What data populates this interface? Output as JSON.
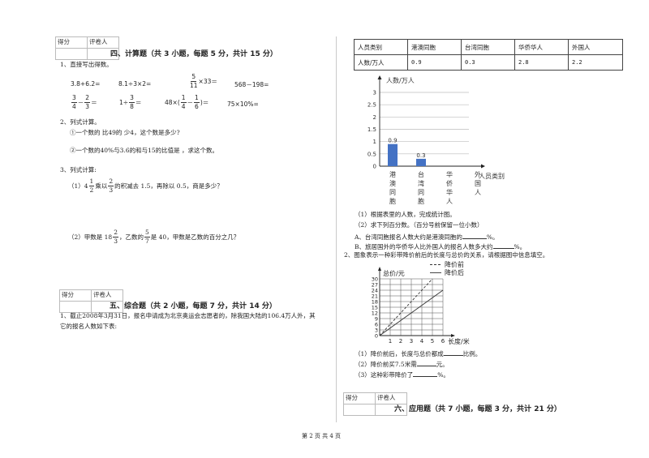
{
  "score_box": {
    "score_label": "得分",
    "grader_label": "评卷人"
  },
  "section4": {
    "title": "四、计算题（共 3 小题，每题 5 分，共计 15 分）",
    "q1": {
      "label": "1、直接写出得数。",
      "row1": [
        "3.8+6.2=",
        "8.1÷3×2=",
        "×33＝",
        "568－198="
      ],
      "frac_5_11": {
        "num": "5",
        "den": "11"
      },
      "row2": {
        "a": {
          "f1": {
            "num": "3",
            "den": "4"
          },
          "op": "－",
          "f2": {
            "num": "2",
            "den": "3"
          },
          "eq": "＝"
        },
        "b": {
          "pre": "1÷",
          "f": {
            "num": "3",
            "den": "8"
          },
          "eq": "＝"
        },
        "c": {
          "pre": "48×(",
          "f1": {
            "num": "1",
            "den": "4"
          },
          "op": "－",
          "f2": {
            "num": "1",
            "den": "6"
          },
          "eq": ")＝"
        },
        "d": "75×10%="
      }
    },
    "q2": {
      "label": "2、列式计算。",
      "item1": "①一个数的 比49的 少4，这个数是多少?",
      "item2": "②一个数的40%与3.6的和与15的比值是 ，求这个数。"
    },
    "q3": {
      "label": "3、列式计算:",
      "item1": {
        "prefix": "（1）4",
        "f1": {
          "num": "1",
          "den": "2"
        },
        "mid": "乘以",
        "f2": {
          "num": "2",
          "den": "3"
        },
        "suffix": "的积减去 1.5，再除以 0.5，商是多少？"
      },
      "item2": {
        "prefix": "（2）甲数是 18",
        "f1": {
          "num": "2",
          "den": "3"
        },
        "mid": "，乙数的",
        "f2": {
          "num": "5",
          "den": "7"
        },
        "suffix": "是 40，甲数是乙数的百分之几？"
      }
    }
  },
  "section5": {
    "title": "五、综合题（共 2 小题，每题 7 分，共计 14 分）",
    "q1_line1": "1、截止2008年3月31日，报名申请成为北京奥运会志愿者的，除我国大陆的106.4万人外，其",
    "q1_line2": "它的报名人数如下表:",
    "table": {
      "header": [
        "人员类别",
        "港澳同胞",
        "台湾同胞",
        "华侨华人",
        "外国人"
      ],
      "row": [
        "人数/万人",
        "0.9",
        "0.3",
        "2.8",
        "2.2"
      ]
    },
    "sub1": "（1）根据表里的人数，完成统计图。",
    "sub2": "（2）求下列百分数。（百分号前保留一位小数）",
    "subA_pre": "A、台湾同胞报名人数大约是港澳同胞的",
    "subA_post": "%。",
    "subB_pre": "B、旅居国外的华侨华人比外国人的报名人数多大约",
    "subB_post": "%。",
    "q2": "2、图象表示一种彩带降价前后的长度与总价的关系，请根据图中信息填空。",
    "q2_sub1_pre": "（1）降价前后，长度与总价都成",
    "q2_sub1_post": "比例。",
    "q2_sub2_pre": "（2）降价前买7.5米需",
    "q2_sub2_post": "元。",
    "q2_sub3_pre": "（3）这种彩带降价了",
    "q2_sub3_post": "%。"
  },
  "section6": {
    "title": "六、应用题（共 7 小题，每题 3 分，共计 21 分）"
  },
  "footer": {
    "page": "第 2 页 共 4 页"
  },
  "chart_data": [
    {
      "type": "bar",
      "title": "",
      "ylabel": "人数/万人",
      "xlabel": "人员类别",
      "categories": [
        "港澳同胞",
        "台湾同胞",
        "华侨华人",
        "外国人"
      ],
      "category_labels_vertical": [
        [
          "港",
          "澳",
          "同",
          "胞"
        ],
        [
          "台",
          "湾",
          "同",
          "胞"
        ],
        [
          "华",
          "侨",
          "华",
          "人"
        ],
        [
          "外",
          "国",
          "人"
        ]
      ],
      "values": [
        0.9,
        0.3,
        null,
        null
      ],
      "data_labels": [
        "0.9",
        "0.3",
        "",
        ""
      ],
      "ylim": [
        0,
        3
      ],
      "yticks": [
        0,
        0.5,
        1,
        1.5,
        2,
        2.5,
        3
      ],
      "ytick_labels": [
        "0",
        "0.5",
        "1",
        "1.5",
        "2",
        "2.5",
        "3"
      ],
      "grid": true,
      "bar_color": "#4472c4"
    },
    {
      "type": "line",
      "title": "",
      "ylabel": "总价/元",
      "xlabel": "长度/米",
      "xlim": [
        0,
        6
      ],
      "ylim": [
        0,
        30
      ],
      "xticks": [
        0,
        1,
        2,
        3,
        4,
        5,
        6
      ],
      "xtick_labels": [
        "1",
        "2",
        "3",
        "4",
        "5",
        "6"
      ],
      "yticks": [
        0,
        3,
        6,
        9,
        12,
        15,
        18,
        21,
        24,
        27,
        30
      ],
      "ytick_labels": [
        "0",
        "3",
        "6",
        "9",
        "12",
        "15",
        "18",
        "21",
        "24",
        "27",
        "30"
      ],
      "grid": true,
      "legend": "top-right",
      "series": [
        {
          "name": "降价前",
          "style": "dashed",
          "x": [
            0,
            5
          ],
          "y": [
            0,
            30
          ]
        },
        {
          "name": "降价后",
          "style": "solid",
          "x": [
            0,
            6
          ],
          "y": [
            0,
            24
          ]
        }
      ]
    }
  ]
}
